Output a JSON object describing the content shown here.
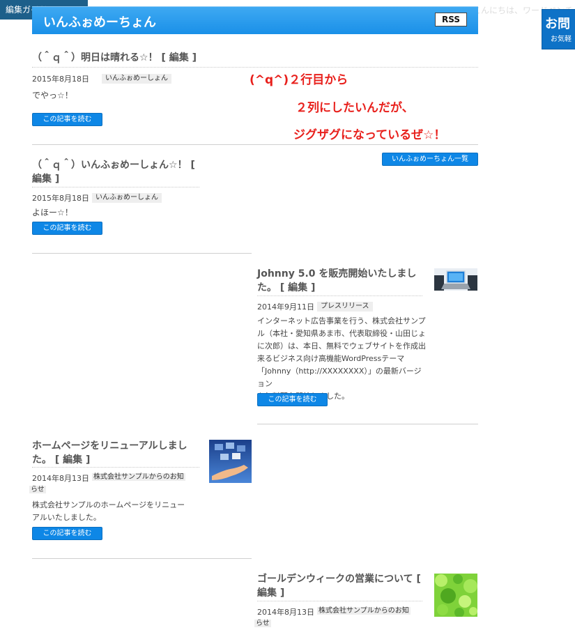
{
  "admin": {
    "edit_guide": "編集ガイド：OPEN",
    "greeting": "こんにちは、ワードペンチ",
    "contact_title": "お問",
    "contact_sub": "お気軽"
  },
  "header": {
    "site_title": "いんふぉめーちょん",
    "rss_label": "RSS"
  },
  "annotation": {
    "line1": "(^q^)２行目から",
    "line2": "２列にしたいんだが、",
    "line3": "ジグザグになっているぜ☆！"
  },
  "list_button": "いんふぉめーちょん一覧",
  "read_more": "この記事を読む",
  "posts": [
    {
      "title": "（＾ｑ＾）明日は晴れる☆！",
      "edit": "[ 編集 ]",
      "date": "2015年8月18日",
      "category": "いんふぉめーしょん",
      "excerpt": "でやっ☆！"
    },
    {
      "title_line1": "（＾ｑ＾）いんふぉめーしょん☆！",
      "edit_line1": "[",
      "edit_line2": "編集 ]",
      "date": "2015年8月18日",
      "category": "いんふぉめーしょん",
      "excerpt": "よほー☆！"
    },
    {
      "title_line1": "Johnny 5.0 を販売開始いたしまし",
      "title_line2": "た。",
      "edit": "[ 編集 ]",
      "date": "2014年9月11日",
      "category": "プレスリリース",
      "excerpt_lines": [
        "インターネット広告事業を行う、株式会社サンプ",
        "ル（本社・愛知県あま市、代表取締役・山田じょ",
        "に次郎）は、本日、無料でウェブサイトを作成出",
        "来るビジネス向け高機能WordPressテーマ",
        "「Johnny（http://XXXXXXXX）」の最新バージョン",
        "を無料配布開始しました。"
      ],
      "thumbnail": "laptop-image"
    },
    {
      "title_line1": "ホームページをリニューアルしまし",
      "title_line2": "た。",
      "edit": "[ 編集 ]",
      "date": "2014年8月13日",
      "category_line1": "株式会社サンプルからのお知",
      "category_line2": "らせ",
      "excerpt_lines": [
        "株式会社サンプルのホームページをリニュー",
        "アルいたしました。"
      ],
      "thumbnail": "hand-holding-screens-image"
    },
    {
      "title_line1": "ゴールデンウィークの営業について",
      "edit_line1": "[",
      "edit_line2": "編集 ]",
      "date": "2014年8月13日",
      "category_line1": "株式会社サンプルからのお知",
      "category_line2": "らせ",
      "thumbnail": "green-leaves-image"
    }
  ]
}
